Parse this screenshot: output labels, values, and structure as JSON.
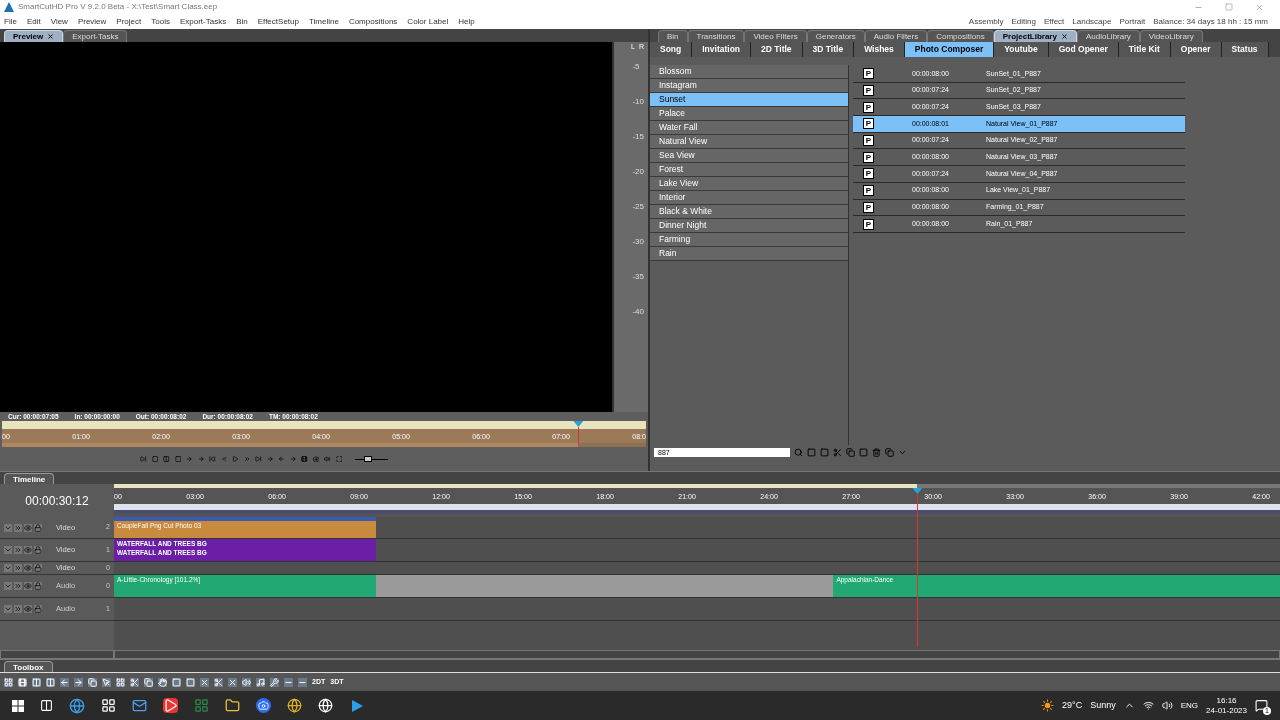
{
  "window": {
    "title": "SmartCutHD Pro V 9.2.0 Beta - X:\\Test\\Smart Class.eep"
  },
  "menu": [
    "File",
    "Edit",
    "View",
    "Preview",
    "Project",
    "Tools",
    "Export-Tasks",
    "Bin",
    "EffectSetup",
    "Timeline",
    "Compositions",
    "Color Label",
    "Help"
  ],
  "workspaces": [
    "Assembly",
    "Editing",
    "Effect",
    "Landscape",
    "Portrait"
  ],
  "balance": "Balance: 34 days 18 hh : 15 mm",
  "preview": {
    "tabs": [
      {
        "label": "Preview",
        "selected": true,
        "closable": true
      },
      {
        "label": "Export-Tasks",
        "selected": false,
        "closable": false
      }
    ],
    "meter_channels": [
      "L",
      "R"
    ],
    "meter_scale": [
      "-5",
      "-10",
      "-15",
      "-20",
      "-25",
      "-30",
      "-35",
      "-40"
    ],
    "info": [
      {
        "label": "Cur:",
        "value": "00:00:07:05"
      },
      {
        "label": "In:",
        "value": "00:00:00:00"
      },
      {
        "label": "Out:",
        "value": "00:00:08:02"
      },
      {
        "label": "Dur:",
        "value": "00:00:08:02"
      },
      {
        "label": "TM:",
        "value": "00:00:08:02"
      }
    ],
    "ruler": [
      "00",
      "01:00",
      "02:00",
      "03:00",
      "04:00",
      "05:00",
      "06:00",
      "07:00",
      "08:0"
    ],
    "playhead": {
      "level": 0.895
    },
    "zoom": {
      "level": 0.4
    }
  },
  "library": {
    "tabs": [
      {
        "label": "Bin",
        "selected": false,
        "closable": false
      },
      {
        "label": "Transitions",
        "selected": false,
        "closable": false
      },
      {
        "label": "Video Filters",
        "selected": false,
        "closable": false
      },
      {
        "label": "Generators",
        "selected": false,
        "closable": false
      },
      {
        "label": "Audio Filters",
        "selected": false,
        "closable": false
      },
      {
        "label": "Compositions",
        "selected": false,
        "closable": false
      },
      {
        "label": "ProjectLibrary",
        "selected": true,
        "closable": true
      },
      {
        "label": "AudioLibrary",
        "selected": false,
        "closable": false
      },
      {
        "label": "VideoLibrary",
        "selected": false,
        "closable": false
      }
    ],
    "categories": [
      {
        "label": "Song",
        "selected": false
      },
      {
        "label": "Invitation",
        "selected": false
      },
      {
        "label": "2D Title",
        "selected": false
      },
      {
        "label": "3D Title",
        "selected": false
      },
      {
        "label": "Wishes",
        "selected": false
      },
      {
        "label": "Photo Composer",
        "selected": true
      },
      {
        "label": "Youtube",
        "selected": false
      },
      {
        "label": "God Opener",
        "selected": false
      },
      {
        "label": "Title Kit",
        "selected": false
      },
      {
        "label": "Opener",
        "selected": false
      },
      {
        "label": "Status",
        "selected": false
      }
    ],
    "groups": [
      {
        "label": "Blossom",
        "selected": false
      },
      {
        "label": "Instagram",
        "selected": false
      },
      {
        "label": "Sunset",
        "selected": true
      },
      {
        "label": "Palace",
        "selected": false
      },
      {
        "label": "Water Fall",
        "selected": false
      },
      {
        "label": "Natural View",
        "selected": false
      },
      {
        "label": "Sea View",
        "selected": false
      },
      {
        "label": "Forest",
        "selected": false
      },
      {
        "label": "Lake View",
        "selected": false
      },
      {
        "label": "Interior",
        "selected": false
      },
      {
        "label": "Black & White",
        "selected": false
      },
      {
        "label": "Dinner Night",
        "selected": false
      },
      {
        "label": "Farming",
        "selected": false
      },
      {
        "label": "Rain",
        "selected": false
      }
    ],
    "items": [
      {
        "badge": "P",
        "duration": "00:00:08:00",
        "name": "SunSet_01_P887",
        "selected": false
      },
      {
        "badge": "P",
        "duration": "00:00:07:24",
        "name": "SunSet_02_P887",
        "selected": false
      },
      {
        "badge": "P",
        "duration": "00:00:07:24",
        "name": "SunSet_03_P887",
        "selected": false
      },
      {
        "badge": "P",
        "duration": "00:00:08:01",
        "name": "Natural View_01_P887",
        "selected": true
      },
      {
        "badge": "P",
        "duration": "00:00:07:24",
        "name": "Natural View_02_P887",
        "selected": false
      },
      {
        "badge": "P",
        "duration": "00:00:08:00",
        "name": "Natural View_03_P887",
        "selected": false
      },
      {
        "badge": "P",
        "duration": "00:00:07:24",
        "name": "Natural View_04_P887",
        "selected": false
      },
      {
        "badge": "P",
        "duration": "00:00:08:00",
        "name": "Lake View_01_P887",
        "selected": false
      },
      {
        "badge": "P",
        "duration": "00:00:08:00",
        "name": "Farming_01_P887",
        "selected": false
      },
      {
        "badge": "P",
        "duration": "00:00:08:00",
        "name": "Rain_01_P887",
        "selected": false
      }
    ],
    "search": {
      "value": "887"
    }
  },
  "timeline": {
    "tab": "Timeline",
    "current_time": "00:00:30:12",
    "ruler": [
      "00",
      "03:00",
      "06:00",
      "09:00",
      "12:00",
      "15:00",
      "18:00",
      "21:00",
      "24:00",
      "27:00",
      "30:00",
      "33:00",
      "36:00",
      "39:00",
      "42:00"
    ],
    "playhead": {
      "level": 0.689
    },
    "tracks": [
      {
        "kind": "video",
        "name": "Video",
        "number": "2",
        "clips": [
          {
            "lines": [
              "CoupleFall Png Cut Photo 03"
            ]
          }
        ]
      },
      {
        "kind": "video",
        "name": "Video",
        "number": "1",
        "clips": [
          {
            "lines": [
              "WATERFALL AND TREES BG",
              "WATERFALL AND TREES BG"
            ]
          }
        ]
      },
      {
        "kind": "video",
        "name": "Video",
        "number": "0"
      },
      {
        "kind": "audio",
        "name": "Audio",
        "number": "0",
        "clips": [
          {
            "lines": [
              "A-Little-Chronology [101.2%]"
            ]
          },
          {
            "lines": [
              "Appalachian-Dance"
            ]
          }
        ]
      },
      {
        "kind": "audio",
        "name": "Audio",
        "number": "1"
      }
    ]
  },
  "toolbox": {
    "tab": "Toolbox",
    "text_tools": [
      "2DT",
      "3DT"
    ]
  },
  "taskbar": {
    "temperature": "29°C",
    "weather": "Sunny",
    "language": "ENG",
    "time": "16:16",
    "date": "24-01-2023",
    "notifications": "1"
  }
}
